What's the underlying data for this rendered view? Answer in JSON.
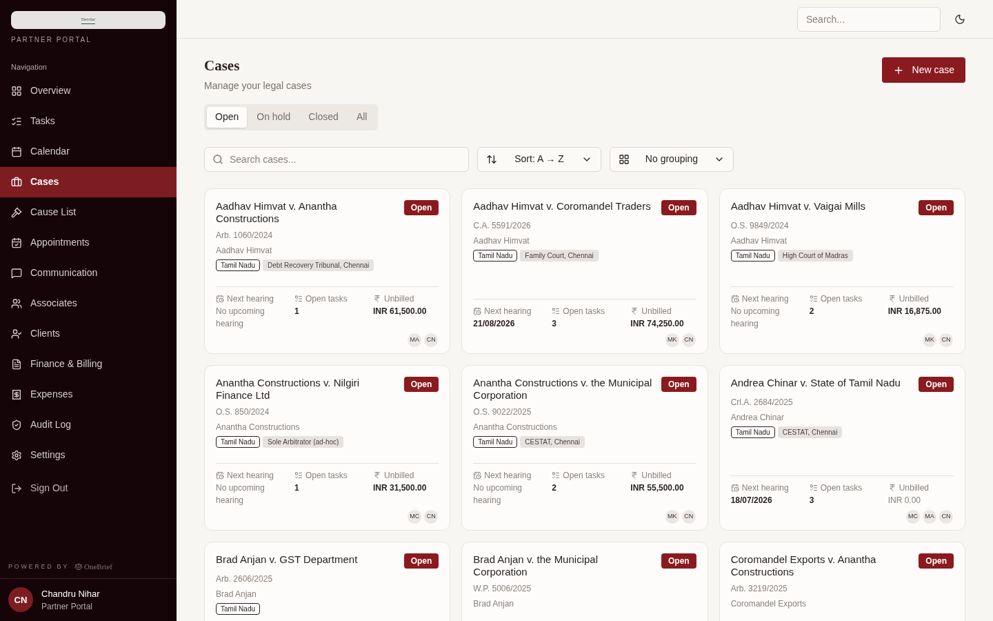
{
  "sidebar": {
    "logo_text": "Devdar",
    "portal_label": "PARTNER PORTAL",
    "section_label": "Navigation",
    "items": [
      {
        "label": "Overview",
        "selected": false
      },
      {
        "label": "Tasks",
        "selected": false
      },
      {
        "label": "Calendar",
        "selected": false
      },
      {
        "label": "Cases",
        "selected": true
      },
      {
        "label": "Cause List",
        "selected": false
      },
      {
        "label": "Appointments",
        "selected": false
      },
      {
        "label": "Communication",
        "selected": false
      },
      {
        "label": "Associates",
        "selected": false
      },
      {
        "label": "Clients",
        "selected": false
      },
      {
        "label": "Finance & Billing",
        "selected": false
      },
      {
        "label": "Expenses",
        "selected": false
      },
      {
        "label": "Audit Log",
        "selected": false
      },
      {
        "label": "Settings",
        "selected": false
      }
    ],
    "sign_out": "Sign Out",
    "powered_by": "POWERED BY",
    "brand": "OneBrief",
    "user": {
      "initials": "CN",
      "name": "Chandru Nihar",
      "role": "Partner Portal"
    }
  },
  "topbar": {
    "search_placeholder": "Search..."
  },
  "page": {
    "title": "Cases",
    "subtitle": "Manage your legal cases",
    "new_button": "New case",
    "tabs": [
      {
        "label": "Open",
        "selected": true
      },
      {
        "label": "On hold",
        "selected": false
      },
      {
        "label": "Closed",
        "selected": false
      },
      {
        "label": "All",
        "selected": false
      }
    ],
    "search_placeholder": "Search cases...",
    "sort": "Sort: A → Z",
    "grouping": "No grouping"
  },
  "cases": [
    {
      "title": "Aadhav Himvat v. Anantha Constructions",
      "status": "Open",
      "number": "Arb. 1060/2024",
      "client": "Aadhav Himvat",
      "tags": [
        "Tamil Nadu",
        "Debt Recovery Tribunal, Chennai"
      ],
      "stat_labels": [
        "Next hearing",
        "Open tasks",
        "Unbilled"
      ],
      "next_hearing": "No upcoming hearing",
      "hearing_scheduled": false,
      "open_tasks": "1",
      "unbilled": "INR 61,500.00",
      "unbilled_due": true,
      "team": [
        "MA",
        "CN"
      ]
    },
    {
      "title": "Aadhav Himvat v. Coromandel Traders",
      "status": "Open",
      "number": "C.A. 5591/2026",
      "client": "Aadhav Himvat",
      "tags": [
        "Tamil Nadu",
        "Family Court, Chennai"
      ],
      "stat_labels": [
        "Next hearing",
        "Open tasks",
        "Unbilled"
      ],
      "next_hearing": "21/08/2026",
      "hearing_scheduled": true,
      "open_tasks": "3",
      "unbilled": "INR 74,250.00",
      "unbilled_due": true,
      "team": [
        "MK",
        "CN"
      ]
    },
    {
      "title": "Aadhav Himvat v. Vaigai Mills",
      "status": "Open",
      "number": "O.S. 9849/2024",
      "client": "Aadhav Himvat",
      "tags": [
        "Tamil Nadu",
        "High Court of Madras"
      ],
      "stat_labels": [
        "Next hearing",
        "Open tasks",
        "Unbilled"
      ],
      "next_hearing": "No upcoming hearing",
      "hearing_scheduled": false,
      "open_tasks": "2",
      "unbilled": "INR 16,875.00",
      "unbilled_due": true,
      "team": [
        "MK",
        "CN"
      ]
    },
    {
      "title": "Anantha Constructions v. Nilgiri Finance Ltd",
      "status": "Open",
      "number": "O.S. 850/2024",
      "client": "Anantha Constructions",
      "tags": [
        "Tamil Nadu",
        "Sole Arbitrator (ad-hoc)"
      ],
      "stat_labels": [
        "Next hearing",
        "Open tasks",
        "Unbilled"
      ],
      "next_hearing": "No upcoming hearing",
      "hearing_scheduled": false,
      "open_tasks": "1",
      "unbilled": "INR 31,500.00",
      "unbilled_due": true,
      "team": [
        "MC",
        "CN"
      ]
    },
    {
      "title": "Anantha Constructions v. the Municipal Corporation",
      "status": "Open",
      "number": "O.S. 9022/2025",
      "client": "Anantha Constructions",
      "tags": [
        "Tamil Nadu",
        "CESTAT, Chennai"
      ],
      "stat_labels": [
        "Next hearing",
        "Open tasks",
        "Unbilled"
      ],
      "next_hearing": "No upcoming hearing",
      "hearing_scheduled": false,
      "open_tasks": "2",
      "unbilled": "INR 55,500.00",
      "unbilled_due": true,
      "team": [
        "MK",
        "CN"
      ]
    },
    {
      "title": "Andrea Chinar v. State of Tamil Nadu",
      "status": "Open",
      "number": "Crl.A. 2684/2025",
      "client": "Andrea Chinar",
      "tags": [
        "Tamil Nadu",
        "CESTAT, Chennai"
      ],
      "stat_labels": [
        "Next hearing",
        "Open tasks",
        "Unbilled"
      ],
      "next_hearing": "18/07/2026",
      "hearing_scheduled": true,
      "open_tasks": "3",
      "unbilled": "INR 0.00",
      "unbilled_due": false,
      "team": [
        "MC",
        "MA",
        "CN"
      ]
    },
    {
      "title": "Brad Anjan v. GST Department",
      "status": "Open",
      "number": "Arb. 2606/2025",
      "client": "Brad Anjan",
      "tags": [
        "Tamil Nadu"
      ]
    },
    {
      "title": "Brad Anjan v. the Municipal Corporation",
      "status": "Open",
      "number": "W.P. 5006/2025",
      "client": "Brad Anjan"
    },
    {
      "title": "Coromandel Exports v. Anantha Constructions",
      "status": "Open",
      "number": "Arb. 3219/2025",
      "client": "Coromandel Exports"
    }
  ]
}
